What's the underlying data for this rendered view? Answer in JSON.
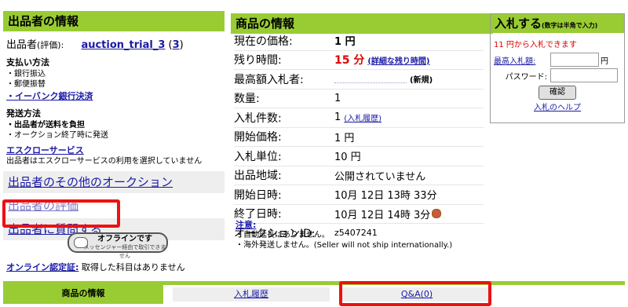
{
  "seller_panel": {
    "header": "出品者の情報",
    "seller_label": "出品者",
    "rating_label": "(評価):",
    "seller_name": "auction_trial_3",
    "rating_open": "(",
    "rating_value": "3",
    "rating_close": ")",
    "payment": {
      "title": "支払い方法",
      "items": [
        "・銀行振込",
        "・郵便振替"
      ],
      "link": "・イーバンク銀行決済"
    },
    "shipping": {
      "title": "発送方法",
      "items": [
        "・出品者が送料を負担",
        "・オークション終了時に発送"
      ]
    },
    "escrow": {
      "link": "エスクローサービス",
      "text": "出品者はエスクローサービスの利用を選択していません"
    },
    "menu": [
      "出品者のその他のオークション",
      "出品者の評価",
      "出品者に質問する"
    ],
    "offline_button": {
      "label": "オフラインです",
      "sub": "メッセンジャー経由で取引できません"
    },
    "online_cert": {
      "label": "オンライン認定証:",
      "text": "取得した科目はありません"
    }
  },
  "item_panel": {
    "header": "商品の情報",
    "rows": [
      {
        "key": "現在の価格:",
        "value": "1 円"
      },
      {
        "key": "残り時間:",
        "value": "15 分",
        "link": "(詳細な残り時間)"
      },
      {
        "key": "最高額入札者:",
        "value": "",
        "note": "(新規)"
      },
      {
        "key": "数量:",
        "value": "1"
      },
      {
        "key": "入札件数:",
        "value": "1",
        "link": "(入札履歴)"
      },
      {
        "key": "開始価格:",
        "value": "1 円"
      },
      {
        "key": "入札単位:",
        "value": "10 円"
      },
      {
        "key": "出品地域:",
        "value": "公開されていません"
      },
      {
        "key": "開始日時:",
        "value": "10月 12日 13時 33分"
      },
      {
        "key": "終了日時:",
        "value": "10月 12日 14時 3分"
      },
      {
        "key": "オークションID:",
        "value": "z5407241"
      }
    ],
    "notes_title": "注意:",
    "notes": [
      "・自動延長はありません。",
      "・海外発送しません。(Seller will not ship internationally.)"
    ]
  },
  "bid_panel": {
    "header": "入札する",
    "header_note": "(数字は半角で入力)",
    "hint": "11 円から入札できます",
    "max_bid_label": "最高入札額:",
    "currency": "円",
    "password_label": "パスワード:",
    "confirm_button": "確認",
    "help_link": "入札のヘルプ"
  },
  "tabs": [
    "商品の情報",
    "入札履歴",
    "Q&A(0)"
  ],
  "colors": {
    "header_green": "#99cc33",
    "link_blue": "#1a1aa6",
    "highlight_red": "#ee1111"
  }
}
